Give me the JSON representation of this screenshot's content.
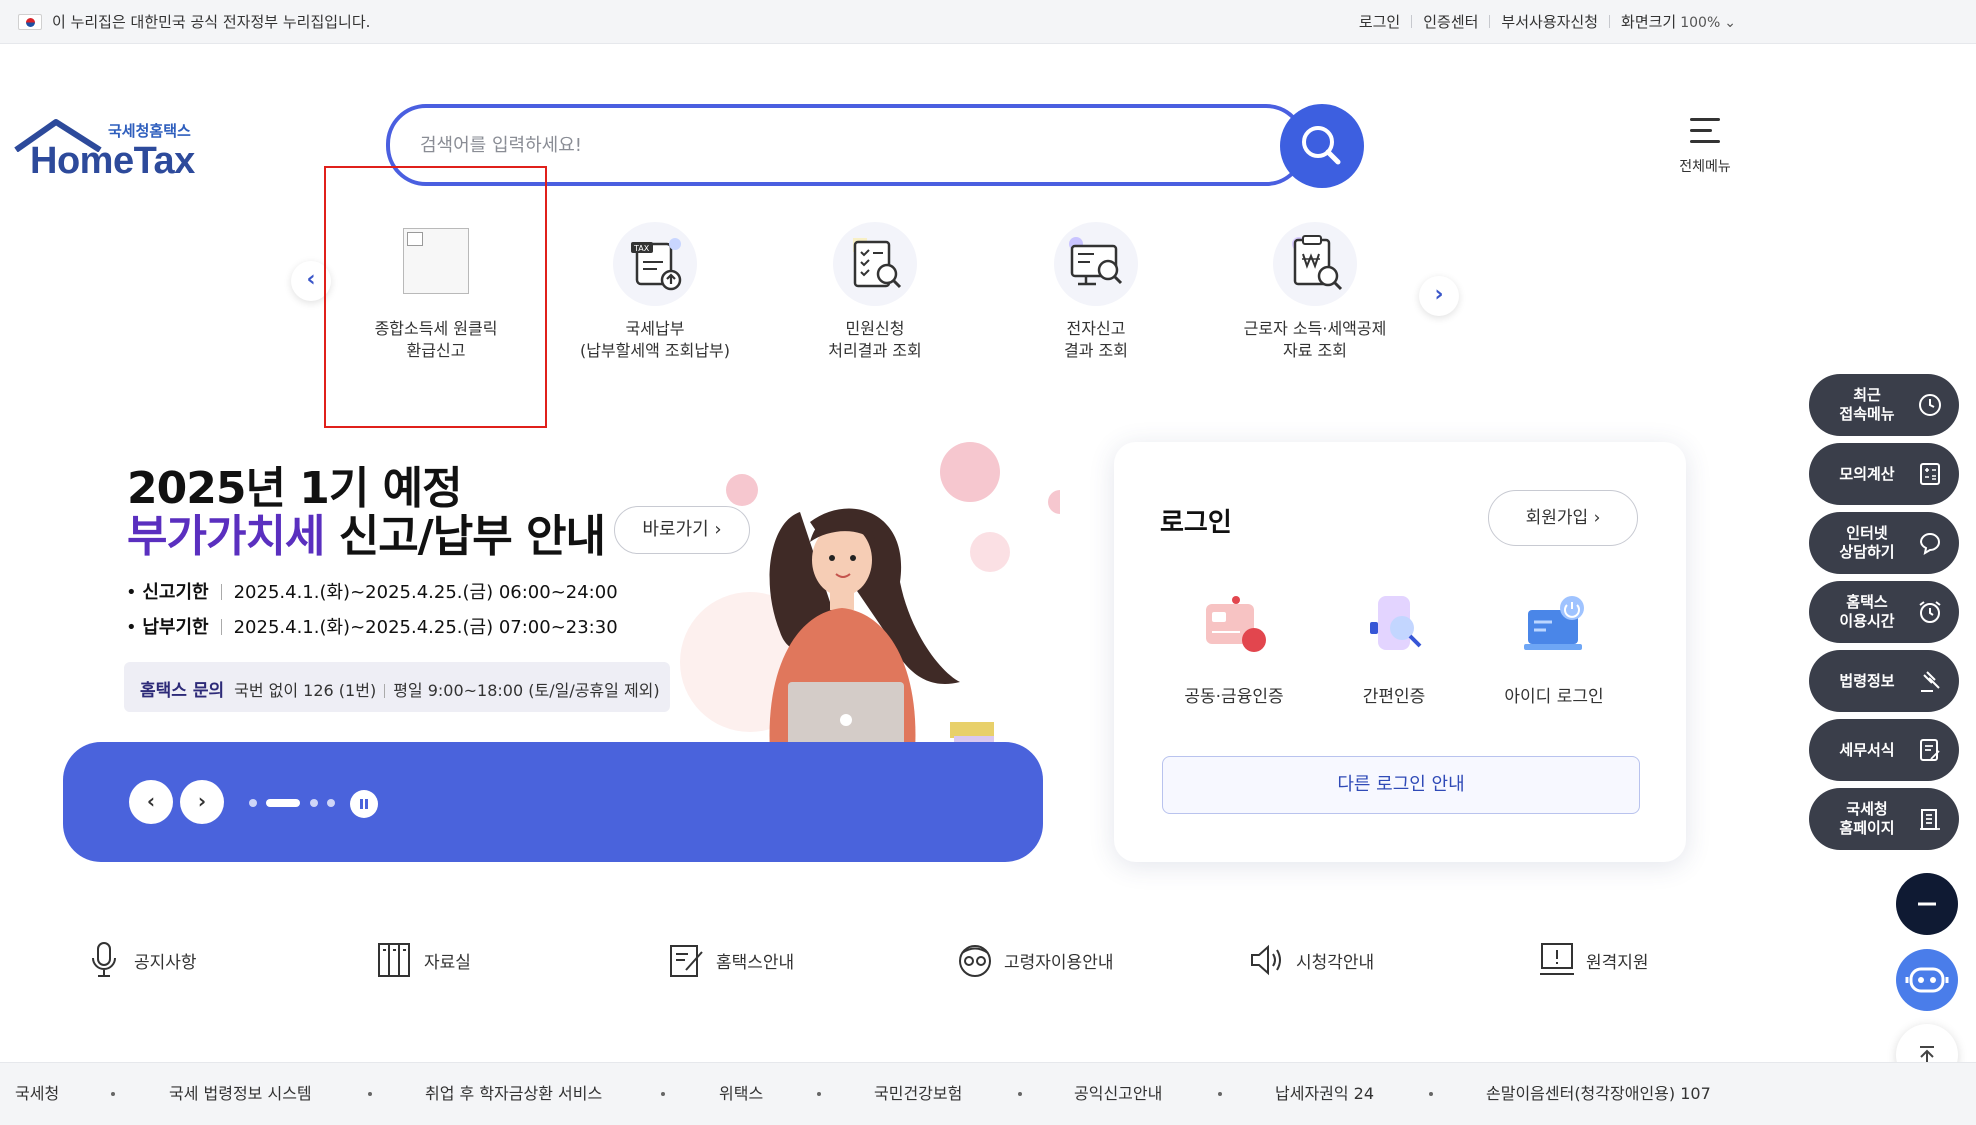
{
  "gov_bar": {
    "text": "이 누리집은 대한민국 공식 전자정부 누리집입니다.",
    "links": [
      "로그인",
      "인증센터",
      "부서사용자신청"
    ],
    "zoom_label": "화면크기",
    "zoom_value": "100%"
  },
  "logo": {
    "small": "국세청홈택스",
    "big": "HomeTax"
  },
  "search": {
    "placeholder": "검색어를 입력하세요!",
    "value": ""
  },
  "all_menu": {
    "label": "전체메뉴"
  },
  "quick_menu": {
    "items": [
      {
        "label": "종합소득세 원클릭\n환급신고",
        "icon": "broken-image-icon"
      },
      {
        "label": "국세납부\n(납부할세액 조회납부)",
        "icon": "tax-payment-icon"
      },
      {
        "label": "민원신청\n처리결과 조회",
        "icon": "document-search-icon"
      },
      {
        "label": "전자신고\n결과 조회",
        "icon": "monitor-search-icon"
      },
      {
        "label": "근로자 소득·세액공제\n자료 조회",
        "icon": "won-document-search-icon"
      }
    ]
  },
  "banner": {
    "line1": "2025년 1기 예정",
    "line2_accent": "부가가치세",
    "line2_rest": " 신고/납부 안내",
    "go_label": "바로가기",
    "rows": [
      {
        "key": "신고기한",
        "value": "2025.4.1.(화)~2025.4.25.(금) 06:00~24:00"
      },
      {
        "key": "납부기한",
        "value": "2025.4.1.(화)~2025.4.25.(금) 07:00~23:30"
      }
    ],
    "inquiry_key": "홈택스 문의",
    "inquiry_phone": "국번 없이 126 (1번)",
    "inquiry_hours": "평일 9:00~18:00 (토/일/공휴일 제외)"
  },
  "login": {
    "title": "로그인",
    "join_label": "회원가입",
    "options": [
      "공동·금융인증",
      "간편인증",
      "아이디 로그인"
    ],
    "other_label": "다른 로그인 안내"
  },
  "side_menu": [
    {
      "label": "최근\n접속메뉴",
      "icon": "clock-icon"
    },
    {
      "label": "모의계산",
      "icon": "calculator-icon"
    },
    {
      "label": "인터넷\n상담하기",
      "icon": "chat-icon"
    },
    {
      "label": "홈택스\n이용시간",
      "icon": "alarm-icon"
    },
    {
      "label": "법령정보",
      "icon": "gavel-icon"
    },
    {
      "label": "세무서식",
      "icon": "form-icon"
    },
    {
      "label": "국세청\n홈페이지",
      "icon": "building-icon"
    }
  ],
  "bottom_links": [
    "공지사항",
    "자료실",
    "홈택스안내",
    "고령자이용안내",
    "시청각안내",
    "원격지원"
  ],
  "footer_links": [
    "국세청",
    "국세 법령정보 시스템",
    "취업 후 학자금상환 서비스",
    "위택스",
    "국민건강보험",
    "공익신고안내",
    "납세자권익 24",
    "손말이음센터(청각장애인용) 107"
  ],
  "colors": {
    "primary": "#3d5fe0",
    "banner_bar": "#4a63dc",
    "accent_purple": "#5a2fbf",
    "side_dark": "#3a3e4a",
    "highlight": "#e0201b"
  }
}
